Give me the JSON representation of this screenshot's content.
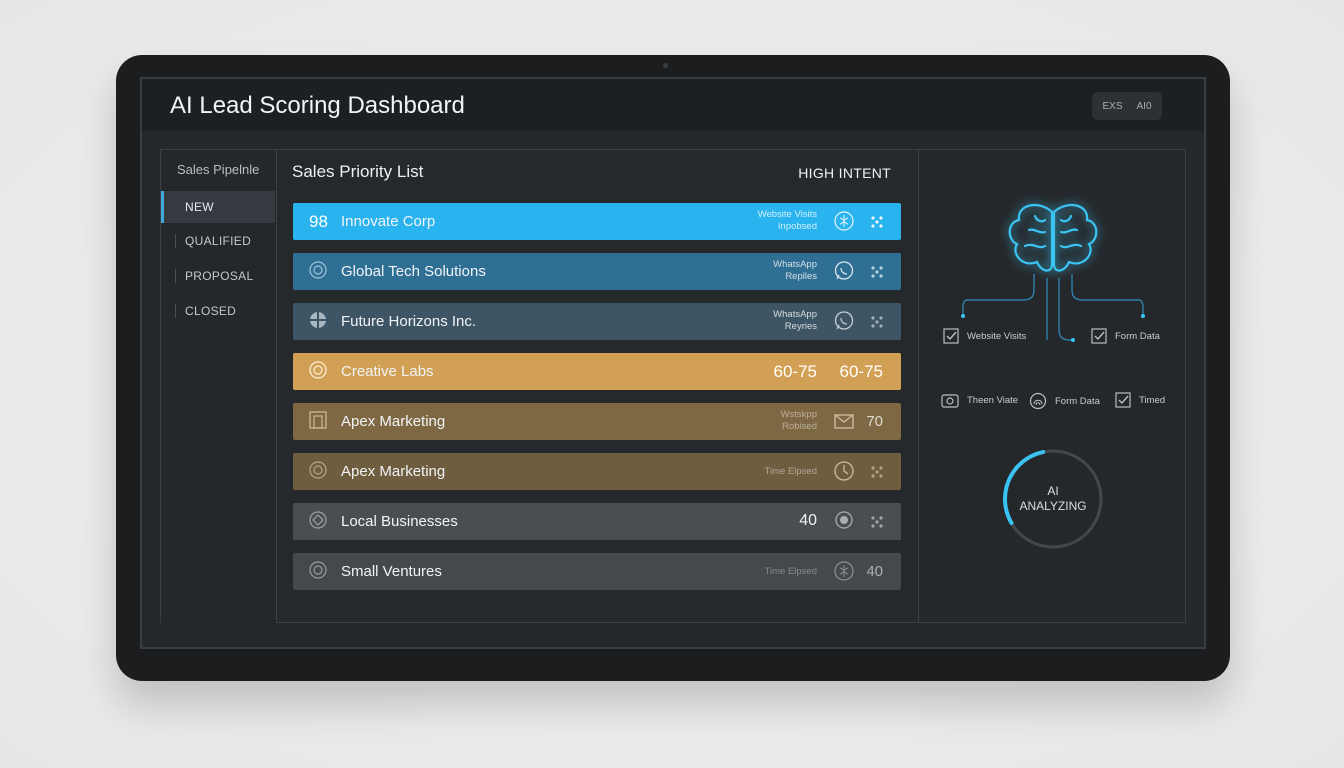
{
  "app": {
    "title": "AI Lead Scoring Dashboard",
    "badge": [
      "EXS",
      "AI0"
    ]
  },
  "sidebar": {
    "title": "Sales Pipelnle",
    "items": [
      {
        "label": "NEW",
        "active": true
      },
      {
        "label": "QUALIFIED",
        "active": false
      },
      {
        "label": "PROPOSAL",
        "active": false
      },
      {
        "label": "CLOSED",
        "active": false
      }
    ]
  },
  "main": {
    "title": "Sales Priority List",
    "tag": "HIGH INTENT",
    "rows": [
      {
        "score_left": "98",
        "name": "Innovate Corp",
        "meta": [
          "Website Visits",
          "Inpobsed"
        ],
        "icon": "brain-icon",
        "right": "dots",
        "color": "#2ab4ef"
      },
      {
        "name": "Global Tech Solutions",
        "meta": [
          "WhatsApp",
          "Replles"
        ],
        "icon": "whatsapp-icon",
        "right": "dots",
        "color": "#2f6f94"
      },
      {
        "name": "Future Horizons Inc.",
        "meta": [
          "WhatsApp",
          "Reyries"
        ],
        "icon": "whatsapp-icon",
        "right": "dots",
        "color": "#3e5566"
      },
      {
        "name": "Creative Labs",
        "score_mid": "60-75",
        "score_right": "60-75",
        "color": "#d2a055"
      },
      {
        "name": "Apex Marketing",
        "meta": [
          "Wstskpp",
          "Robised"
        ],
        "icon": "mail-icon",
        "score_right": "70",
        "color": "#7e6844"
      },
      {
        "name": "Apex Marketing",
        "meta": [
          "Time Elpsed"
        ],
        "icon": "clock-icon",
        "right": "dots",
        "color": "#6e5d3f"
      },
      {
        "name": "Local Businesses",
        "score_mid": "40",
        "icon": "badge-icon",
        "right": "dots",
        "color": "#4a4e52"
      },
      {
        "name": "Small Ventures",
        "meta": [
          "Time Elpsed"
        ],
        "icon": "brain-icon",
        "score_right": "40",
        "color": "#45494d"
      }
    ]
  },
  "ai_panel": {
    "signals_top": [
      "Website Visits",
      "Form Data"
    ],
    "signals_bottom": [
      "Theen Viate",
      "Form Data",
      "Timed"
    ],
    "status": [
      "AI",
      "ANALYZING"
    ],
    "progress_fraction": 0.3
  },
  "colors": {
    "accent": "#3ac3f2"
  }
}
